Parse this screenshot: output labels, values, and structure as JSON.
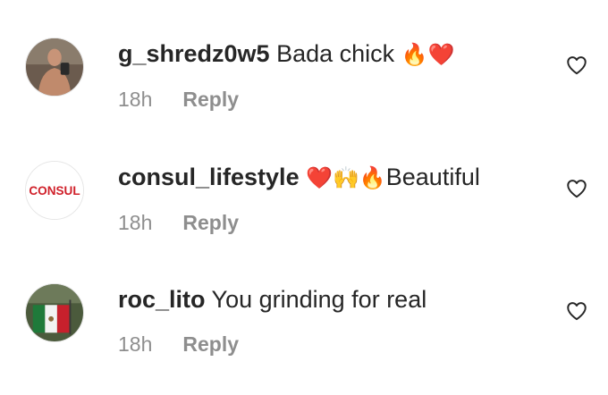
{
  "comments": [
    {
      "username": "g_shredz0w5",
      "text": "Bada    chick",
      "emoji": "🔥❤️",
      "time": "18h",
      "reply_label": "Reply",
      "avatar_icon": "shirtless-selfie-avatar",
      "like_icon": "heart-outline-icon"
    },
    {
      "username": "consul_lifestyle",
      "text": "Beautiful",
      "emoji": "❤️🙌🔥",
      "time": "18h",
      "reply_label": "Reply",
      "avatar_icon": "consul-logo-avatar",
      "avatar_logo_text": "CONSUL",
      "like_icon": "heart-outline-icon"
    },
    {
      "username": "roc_lito",
      "text": "You grinding for real",
      "time": "18h",
      "reply_label": "Reply",
      "avatar_icon": "flag-avatar",
      "like_icon": "heart-outline-icon"
    }
  ],
  "colors": {
    "text": "#262626",
    "meta": "#8e8e8e",
    "consul_red": "#d0202a"
  }
}
